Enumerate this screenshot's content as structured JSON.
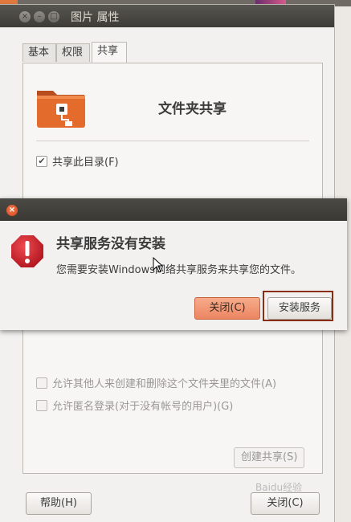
{
  "properties_window": {
    "title": "图片 属性",
    "tabs": [
      {
        "label": "基本",
        "active": false
      },
      {
        "label": "权限",
        "active": false
      },
      {
        "label": "共享",
        "active": true
      }
    ],
    "share_heading": "文件夹共享",
    "share_checkbox": {
      "label": "共享此目录(F)",
      "checked": true
    },
    "allow_others_checkbox": {
      "label": "允许其他人来创建和删除这个文件夹里的文件(A)",
      "checked": false
    },
    "guest_checkbox": {
      "label": "允许匿名登录(对于没有帐号的用户)(G)",
      "checked": false
    },
    "create_share_button": "创建共享(S)",
    "help_button": "帮助(H)",
    "close_button": "关闭(C)"
  },
  "alert_dialog": {
    "heading": "共享服务没有安装",
    "message": "您需要安装Windows网络共享服务来共享您的文件。",
    "close_button": "关闭(C)",
    "install_button": "安装服务"
  },
  "icons": {
    "window_close": "close-icon",
    "window_minimize": "minimize-icon",
    "window_maximize": "maximize-icon",
    "folder": "shared-folder-icon",
    "alert": "error-icon"
  },
  "colors": {
    "accent_orange": "#ec8562",
    "error_red": "#cc1f2c",
    "titlebar_dark": "#3e3c37",
    "highlight_outline": "#8a2d15"
  },
  "watermark": "Baidu经验"
}
